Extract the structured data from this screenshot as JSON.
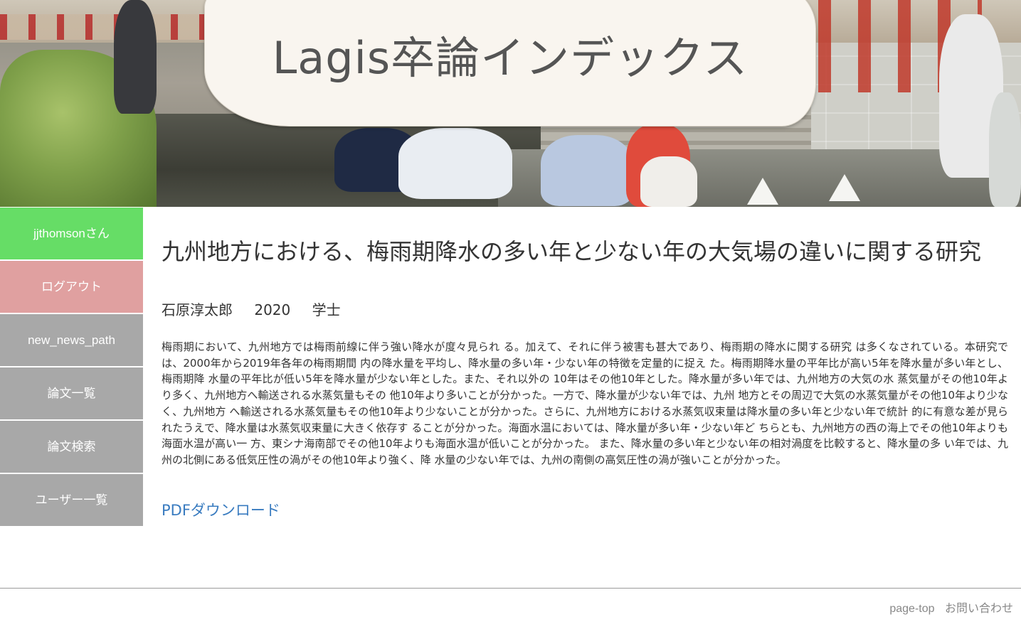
{
  "header": {
    "site_title": "Lagis卒論インデックス"
  },
  "sidebar": {
    "items": [
      {
        "label": "jjthomsonさん"
      },
      {
        "label": "ログアウト"
      },
      {
        "label": "new_news_path"
      },
      {
        "label": "論文一覧"
      },
      {
        "label": "論文検索"
      },
      {
        "label": "ユーザー一覧"
      }
    ]
  },
  "paper": {
    "title": "九州地方における、梅雨期降水の多い年と少ない年の大気場の違いに関する研究",
    "author": "石原淳太郎",
    "year": "2020",
    "degree": "学士",
    "abstract": "梅雨期において、九州地方では梅雨前線に伴う強い降水が度々見られ る。加えて、それに伴う被害も甚大であり、梅雨期の降水に関する研究 は多くなされている。本研究では、2000年から2019年各年の梅雨期間 内の降水量を平均し、降水量の多い年・少ない年の特徴を定量的に捉え た。梅雨期降水量の平年比が高い5年を降水量が多い年とし、梅雨期降 水量の平年比が低い5年を降水量が少ない年とした。また、それ以外の 10年はその他10年とした。降水量が多い年では、九州地方の大気の水 蒸気量がその他10年より多く、九州地方へ輸送される水蒸気量もその 他10年より多いことが分かった。一方で、降水量が少ない年では、九州 地方とその周辺で大気の水蒸気量がその他10年より少なく、九州地方 へ輸送される水蒸気量もその他10年より少ないことが分かった。さらに、九州地方における水蒸気収束量は降水量の多い年と少ない年で統計 的に有意な差が見られたうえで、降水量は水蒸気収束量に大きく依存す ることが分かった。海面水温においては、降水量が多い年・少ない年ど ちらとも、九州地方の西の海上でその他10年よりも海面水温が高い一 方、東シナ海南部でその他10年よりも海面水温が低いことが分かった。 また、降水量の多い年と少ない年の相対渦度を比較すると、降水量の多 い年では、九州の北側にある低気圧性の渦がその他10年より強く、降 水量の少ない年では、九州の南側の高気圧性の渦が強いことが分かった。",
    "pdf_label": "PDFダウンロード"
  },
  "footer": {
    "page_top": "page-top",
    "contact": "お問い合わせ"
  },
  "colors": {
    "user_item": "#66dd66",
    "logout_item": "#e0a0a0",
    "nav_item": "#a8a8a8",
    "link": "#3a7cc0"
  }
}
